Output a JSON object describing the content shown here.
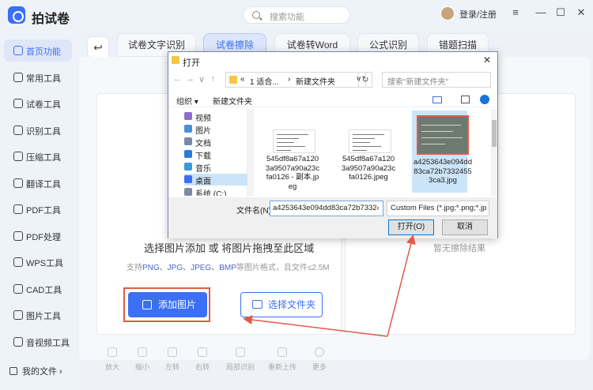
{
  "app": {
    "title": "拍试卷",
    "search_placeholder": "搜索功能",
    "login": "登录/注册"
  },
  "window_controls": [
    "≡",
    "—",
    "☐",
    "✕"
  ],
  "sidebar": {
    "items": [
      {
        "label": "首页功能",
        "icon": "home-icon",
        "active": true
      },
      {
        "label": "常用工具",
        "icon": "layers-icon"
      },
      {
        "label": "试卷工具",
        "icon": "paper-icon"
      },
      {
        "label": "识别工具",
        "icon": "scan-icon"
      },
      {
        "label": "压缩工具",
        "icon": "compress-icon"
      },
      {
        "label": "翻译工具",
        "icon": "translate-icon"
      },
      {
        "label": "PDF工具",
        "icon": "pdf-icon"
      },
      {
        "label": "PDF处理",
        "icon": "pdf-process-icon"
      },
      {
        "label": "WPS工具",
        "icon": "wps-icon"
      },
      {
        "label": "CAD工具",
        "icon": "cad-icon"
      },
      {
        "label": "图片工具",
        "icon": "image-icon"
      },
      {
        "label": "音视频工具",
        "icon": "media-icon"
      }
    ],
    "my_files": "我的文件 ›"
  },
  "main": {
    "back": "↩",
    "tabs": [
      {
        "label": "试卷文字识别"
      },
      {
        "label": "试卷擦除",
        "active": true
      },
      {
        "label": "试卷转Word"
      },
      {
        "label": "公式识别"
      },
      {
        "label": "错题扫描"
      }
    ],
    "prompt": "选择图片添加 或 将图片拖拽至此区域",
    "formats_prefix": "支持",
    "formats_list": "PNG、JPG、JPEG、BMP",
    "formats_suffix": "等图片格式，且文件≤2.5M",
    "add_image": "添加图片",
    "select_folder": "选择文件夹",
    "no_result": "暂无擦除结果",
    "tools": [
      "放大",
      "缩小",
      "左转",
      "右转",
      "局部识别",
      "重新上传",
      "更多"
    ]
  },
  "dialog": {
    "title": "打开",
    "close": "✕",
    "nav": [
      "←",
      "→",
      "∨",
      "↑"
    ],
    "breadcrumb": [
      "«",
      "1 适合...",
      "›",
      "新建文件夹",
      "∨"
    ],
    "refresh": "↻",
    "search_placeholder": "搜索\"新建文件夹\"",
    "organize": "组织 ▾",
    "new_folder": "新建文件夹",
    "tree": [
      {
        "label": "视频",
        "color": "#8a6fd1"
      },
      {
        "label": "图片",
        "color": "#4a90d9"
      },
      {
        "label": "文档",
        "color": "#7a8aa6"
      },
      {
        "label": "下载",
        "color": "#2a7bd6"
      },
      {
        "label": "音乐",
        "color": "#3a9ad9"
      },
      {
        "label": "桌面",
        "color": "#3b6ff5",
        "selected": true
      },
      {
        "label": "系统 (C:)",
        "color": "#7a8aa6"
      }
    ],
    "files": [
      {
        "name": "545df8a67a1203a9507a90a23cfa0126 - 副本.jpeg"
      },
      {
        "name": "545df8a67a1203a9507a90a23cfa0126.jpeg"
      },
      {
        "name": "a4253643e094dd83ca72b73324553ca3.jpg",
        "selected": true
      }
    ],
    "filename_label": "文件名(N):",
    "filename_value": "a4253643e094dd83ca72b7332‹",
    "filetype": "Custom Files (*.jpg;*.png;*.jp",
    "open": "打开(O)",
    "cancel": "取消"
  },
  "colors": {
    "accent": "#3b6ff5",
    "highlight": "#e05a4a"
  }
}
